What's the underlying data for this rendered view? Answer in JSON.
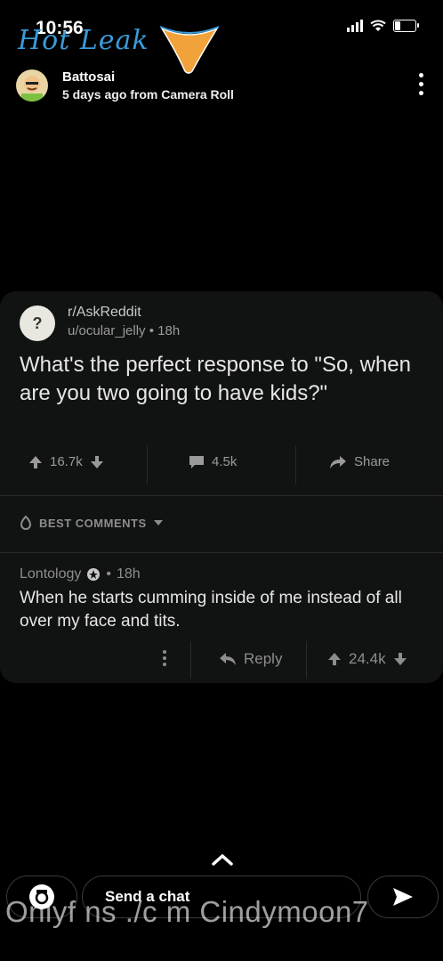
{
  "status": {
    "time": "10:56"
  },
  "sticker": {
    "text": "Hot Leak"
  },
  "header": {
    "user": "Battosai",
    "subtitle": "5 days ago from Camera Roll"
  },
  "post": {
    "subreddit": "r/AskReddit",
    "author": "u/ocular_jelly",
    "age": "18h",
    "title": "What's the perfect response to \"So, when are you two going to have kids?\"",
    "upvotes": "16.7k",
    "comments": "4.5k",
    "share_label": "Share"
  },
  "best_comments": {
    "label": "BEST COMMENTS"
  },
  "comment": {
    "author": "Lontology",
    "age": "18h",
    "body": "When he starts cumming inside of me instead of all over my face and tits.",
    "reply_label": "Reply",
    "score": "24.4k"
  },
  "chat": {
    "placeholder": "Send a chat"
  },
  "watermark": {
    "text": "Onlyf ns ./c m Cindymoon7"
  },
  "colors": {
    "accent": "#3a9bd8",
    "sticker_fig": "#f2a23a",
    "card_bg": "#111312"
  },
  "icons": [
    "signal-icon",
    "wifi-icon",
    "battery-icon",
    "menu-icon",
    "upvote-icon",
    "downvote-icon",
    "comment-icon",
    "share-icon",
    "flame-icon",
    "chevron-down-icon",
    "gold-award-icon",
    "more-icon",
    "reply-icon",
    "camera-icon",
    "send-icon",
    "chevron-up-icon"
  ]
}
